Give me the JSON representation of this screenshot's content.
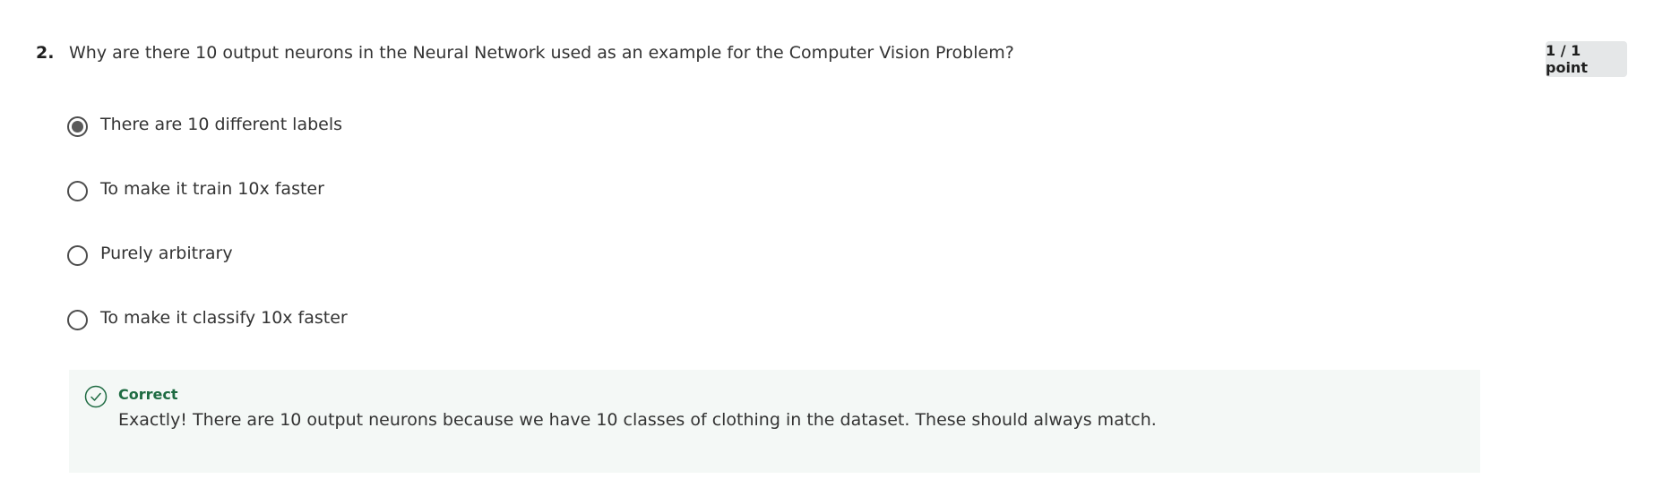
{
  "question": {
    "number": "2.",
    "text": "Why are there 10 output neurons in the Neural Network used as an example for the Computer Vision Problem?",
    "points": "1 / 1 point"
  },
  "options": [
    {
      "label": "There are 10 different labels",
      "selected": true
    },
    {
      "label": "To make it train 10x faster",
      "selected": false
    },
    {
      "label": "Purely arbitrary",
      "selected": false
    },
    {
      "label": "To make it classify 10x faster",
      "selected": false
    }
  ],
  "feedback": {
    "title": "Correct",
    "text": "Exactly! There are 10 output neurons because we have 10 classes of clothing in the dataset. These should always match.",
    "icon": "check-circle-icon",
    "accent_color": "#1e6b42"
  }
}
